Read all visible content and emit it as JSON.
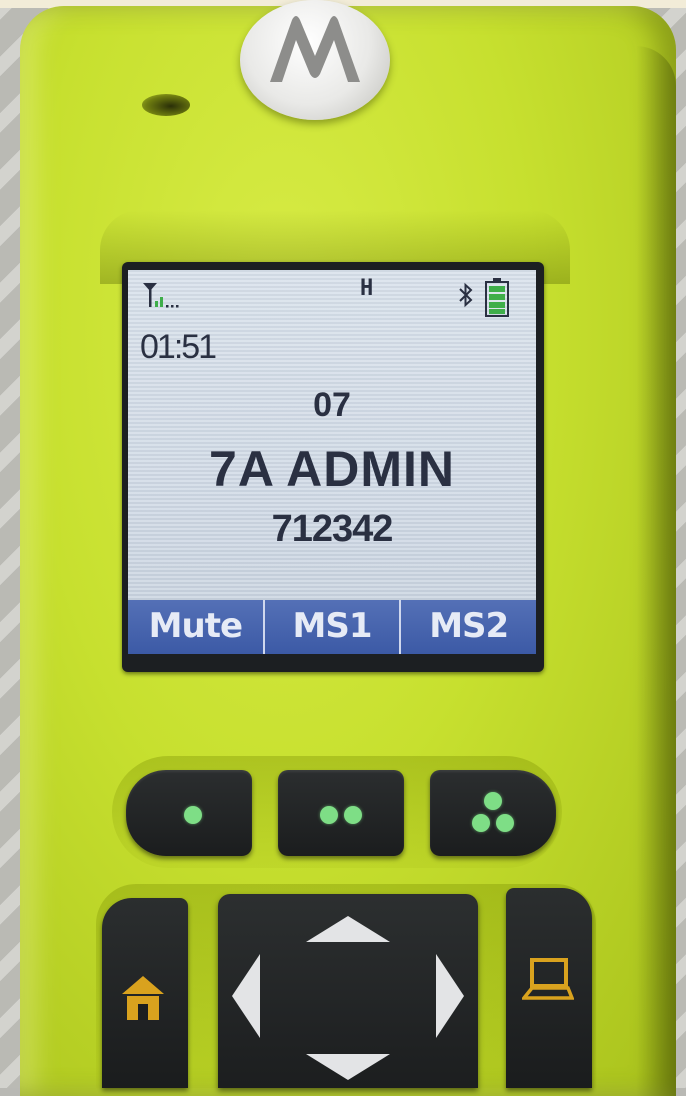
{
  "device": {
    "brand_icon": "motorola-batwing-logo-icon",
    "body_color": "#c7e02f"
  },
  "display": {
    "status_bar": {
      "signal_icon": "signal-strength-icon",
      "mode_indicator": "H",
      "bluetooth_icon": "bluetooth-icon",
      "battery_icon": "battery-full-icon",
      "battery_color": "#3fae4a"
    },
    "time": "01:51",
    "channel_number": "07",
    "zone_name": "7A ADMIN",
    "unit_id": "712342",
    "softkeys": [
      {
        "label": "Mute"
      },
      {
        "label": "MS1"
      },
      {
        "label": "MS2"
      }
    ],
    "softkey_bar_color": "#3c5aa6"
  },
  "programmable_buttons": [
    {
      "name": "one-dot-button",
      "icon": "one-dot-icon"
    },
    {
      "name": "two-dot-button",
      "icon": "two-dot-icon"
    },
    {
      "name": "three-dot-button",
      "icon": "three-dot-icon"
    }
  ],
  "navigation": {
    "home_icon": "home-icon",
    "menu_icon": "laptop-menu-icon",
    "icon_color": "#d9a21e",
    "dpad_icons": [
      "arrow-up-icon",
      "arrow-down-icon",
      "arrow-left-icon",
      "arrow-right-icon"
    ]
  }
}
